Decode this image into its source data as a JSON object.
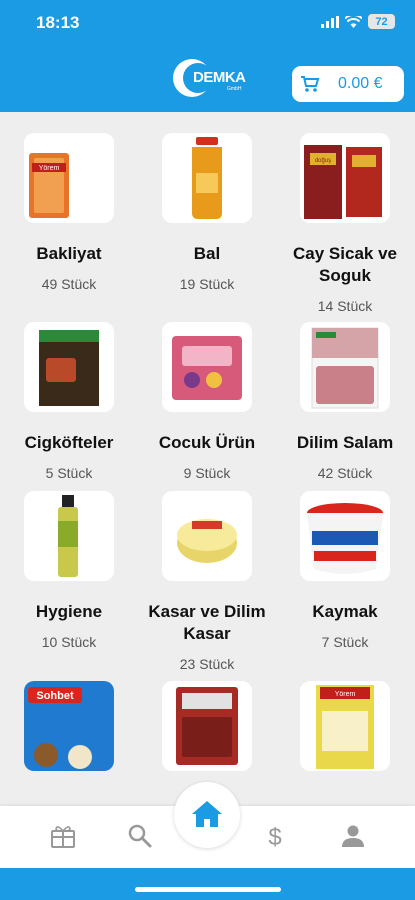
{
  "status": {
    "time": "18:13",
    "battery": "72"
  },
  "header": {
    "logo_text": "DEMKA",
    "logo_sub": "GmbH",
    "cart_total": "0.00 €"
  },
  "categories": [
    {
      "name": "Bakliyat",
      "count": "49 Stück"
    },
    {
      "name": "Bal",
      "count": "19 Stück"
    },
    {
      "name": "Cay Sicak ve Soguk",
      "count": "14 Stück"
    },
    {
      "name": "Cigköfteler",
      "count": "5 Stück"
    },
    {
      "name": "Cocuk Ürün",
      "count": "9 Stück"
    },
    {
      "name": "Dilim Salam",
      "count": "42 Stück"
    },
    {
      "name": "Hygiene",
      "count": "10 Stück"
    },
    {
      "name": "Kasar ve Dilim Kasar",
      "count": "23 Stück"
    },
    {
      "name": "Kaymak",
      "count": "7 Stück"
    }
  ],
  "product_labels": {
    "yorem": "Yörem",
    "sohbet": "Sohbet",
    "dogus": "doğuş",
    "yayla": "Yayla"
  },
  "nav": [
    "gift-icon",
    "search-icon",
    "home-icon",
    "dollar-icon",
    "person-icon"
  ],
  "colors": {
    "primary": "#1a9be4",
    "background": "#eeeeee",
    "card": "#ffffff"
  }
}
